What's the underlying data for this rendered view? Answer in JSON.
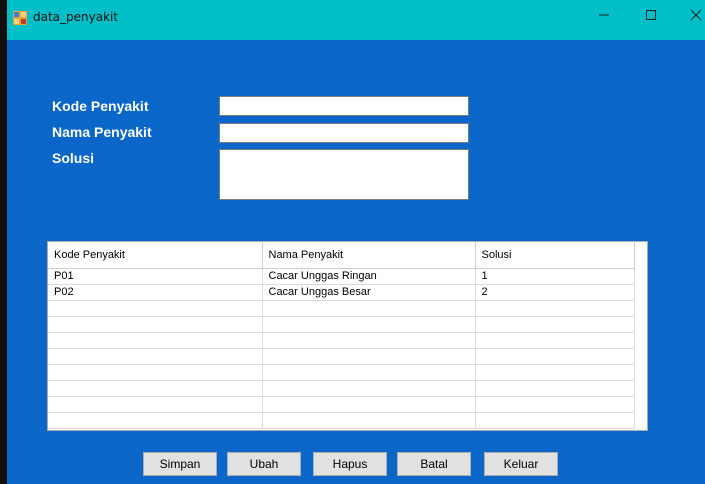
{
  "window": {
    "title": "data_penyakit",
    "icon": "app-form-icon",
    "controls": {
      "minimize": "minimize-icon",
      "maximize": "maximize-icon",
      "close": "close-icon"
    }
  },
  "form": {
    "kode_label": "Kode Penyakit",
    "kode_value": "",
    "nama_label": "Nama Penyakit",
    "nama_value": "",
    "solusi_label": "Solusi",
    "solusi_value": ""
  },
  "grid": {
    "columns": [
      "Kode Penyakit",
      "Nama Penyakit",
      "Solusi"
    ],
    "rows": [
      [
        "P01",
        "Cacar Unggas Ringan",
        "1"
      ],
      [
        "P02",
        "Cacar Unggas Besar",
        "2"
      ],
      [
        "",
        "",
        ""
      ],
      [
        "",
        "",
        ""
      ],
      [
        "",
        "",
        ""
      ],
      [
        "",
        "",
        ""
      ],
      [
        "",
        "",
        ""
      ],
      [
        "",
        "",
        ""
      ],
      [
        "",
        "",
        ""
      ],
      [
        "",
        "",
        ""
      ]
    ]
  },
  "buttons": {
    "simpan": "Simpan",
    "ubah": "Ubah",
    "hapus": "Hapus",
    "batal": "Batal",
    "keluar": "Keluar"
  },
  "colors": {
    "titlebar": "#01bfc8",
    "form_background": "#0a66c8",
    "label_text": "#ffffff"
  }
}
